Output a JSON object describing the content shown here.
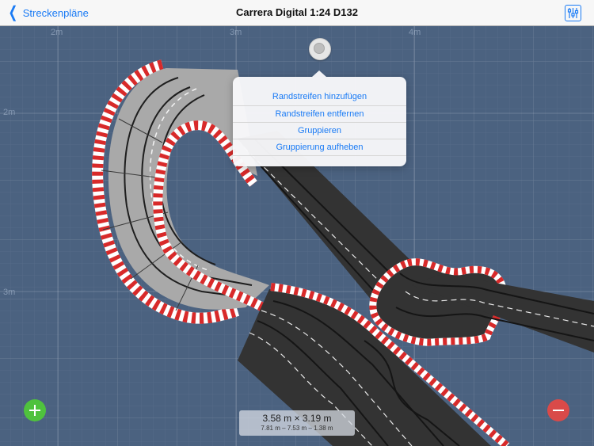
{
  "navbar": {
    "back_label": "Streckenpläne",
    "title": "Carrera Digital 1:24 D132"
  },
  "grid": {
    "x_labels": [
      "2m",
      "3m",
      "4m"
    ],
    "y_labels": [
      "2m",
      "3m"
    ]
  },
  "context_menu": {
    "items": [
      "Randstreifen hinzufügen",
      "Randstreifen entfernen",
      "Gruppieren",
      "Gruppierung aufheben"
    ]
  },
  "dimensions": {
    "main": "3.58 m × 3.19 m",
    "sub": "7.81 m – 7.53 m – 1.38 m"
  },
  "icons": {
    "back": "chevron-left-icon",
    "settings": "sliders-icon",
    "add": "plus-icon",
    "remove": "minus-icon"
  },
  "colors": {
    "accent": "#1a7bf5",
    "background": "#4b6280",
    "add": "#4fc23d",
    "remove": "#d94a49",
    "curb_red": "#d82a2a"
  }
}
